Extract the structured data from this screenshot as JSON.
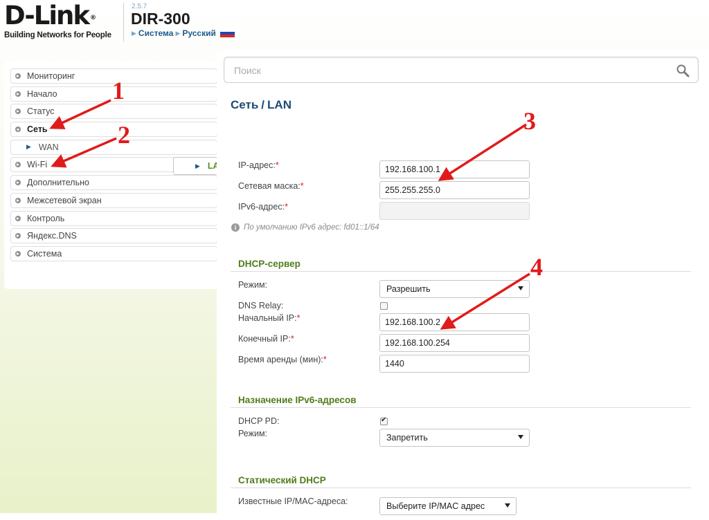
{
  "header": {
    "logo_main": "D-Link",
    "logo_reg": "®",
    "logo_sub": "Building Networks for People",
    "firmware": "2.5.7",
    "model": "DIR-300",
    "link_system": "Система",
    "link_language": "Русский"
  },
  "sidebar": {
    "items": [
      {
        "label": "Мониторинг"
      },
      {
        "label": "Начало"
      },
      {
        "label": "Статус"
      },
      {
        "label": "Сеть"
      },
      {
        "label": "WAN"
      },
      {
        "label": "LAN"
      },
      {
        "label": "Wi-Fi"
      },
      {
        "label": "Дополнительно"
      },
      {
        "label": "Межсетевой экран"
      },
      {
        "label": "Контроль"
      },
      {
        "label": "Яндекс.DNS"
      },
      {
        "label": "Система"
      }
    ]
  },
  "search": {
    "placeholder": "Поиск"
  },
  "page": {
    "crumb_parent": "Сеть",
    "crumb_sep": "/",
    "crumb_current": "LAN"
  },
  "lan": {
    "ip_label": "IP-адрес:",
    "ip_value": "192.168.100.1",
    "mask_label": "Сетевая маска:",
    "mask_value": "255.255.255.0",
    "ipv6_label": "IPv6-адрес:",
    "ipv6_value": "",
    "ipv6_hint": "По умолчанию IPv6 адрес: fd01::1/64",
    "required_mark": "*"
  },
  "dhcp": {
    "title": "DHCP-сервер",
    "mode_label": "Режим:",
    "mode_value": "Разрешить",
    "relay_label": "DNS Relay:",
    "relay_checked": false,
    "start_label": "Начальный IP:",
    "start_value": "192.168.100.2",
    "end_label": "Конечный IP:",
    "end_value": "192.168.100.254",
    "lease_label": "Время аренды (мин):",
    "lease_value": "1440"
  },
  "ipv6_assign": {
    "title": "Назначение IPv6-адресов",
    "pd_label": "DHCP PD:",
    "pd_checked": true,
    "mode_label": "Режим:",
    "mode_value": "Запретить"
  },
  "static_dhcp": {
    "title": "Статический DHCP",
    "known_label": "Известные IP/MAC-адреса:",
    "known_value": "Выберите IP/MAC адрес"
  },
  "annotations": {
    "n1": "1",
    "n2": "2",
    "n3": "3",
    "n4": "4"
  },
  "colors": {
    "arrow": "#e01b1b",
    "section_title": "#4f7d1a",
    "link": "#1d5a8c"
  }
}
